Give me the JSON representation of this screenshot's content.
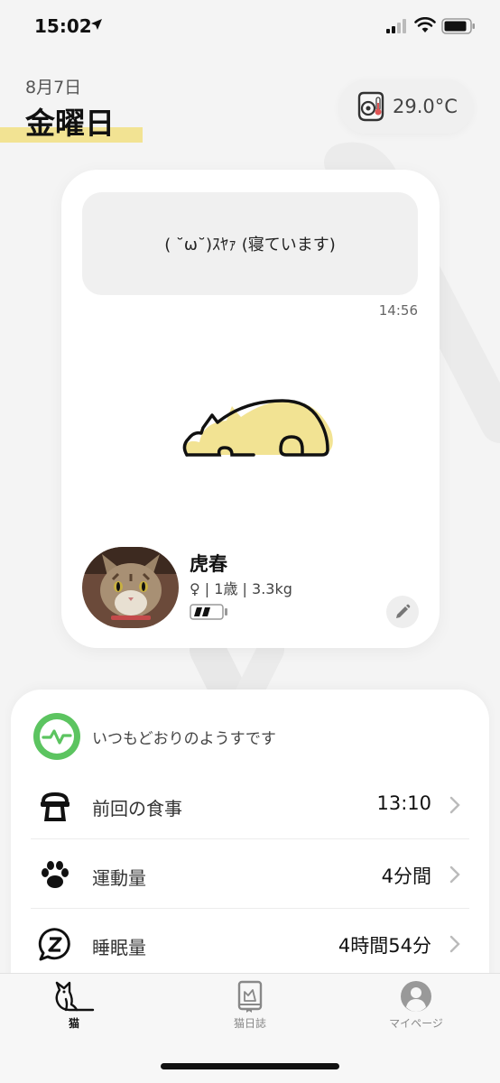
{
  "status_bar": {
    "time": "15:02"
  },
  "header": {
    "date": "8月7日",
    "weekday": "金曜日",
    "temperature": "29.0°C",
    "temperature_icon": "thermometer-device-icon"
  },
  "cat_card": {
    "message": "( ˘ω˘)ｽﾔｧ (寝ています)",
    "message_time": "14:56",
    "state_icon": "sleeping-cat-icon",
    "name": "虎春",
    "meta": "♀ | 1歳 | 3.3kg",
    "battery_level": 0.66,
    "edit_icon": "pencil-icon"
  },
  "status_sheet": {
    "health_text": "いつもどおりのようすです",
    "health_color": "#5cc460",
    "stats": [
      {
        "label": "前回の食事",
        "value": "13:10",
        "icon": "food-bowl-icon"
      },
      {
        "label": "運動量",
        "value": "4分間",
        "icon": "paw-icon"
      },
      {
        "label": "睡眠量",
        "value": "4時間54分",
        "icon": "sleep-z-icon"
      }
    ]
  },
  "tabs": [
    {
      "label": "猫",
      "icon": "cat-icon",
      "active": true
    },
    {
      "label": "猫日誌",
      "icon": "diary-icon",
      "active": false
    },
    {
      "label": "マイページ",
      "icon": "profile-icon",
      "active": false
    }
  ],
  "colors": {
    "accent_yellow": "#f2e393",
    "background": "#f4f4f4"
  }
}
